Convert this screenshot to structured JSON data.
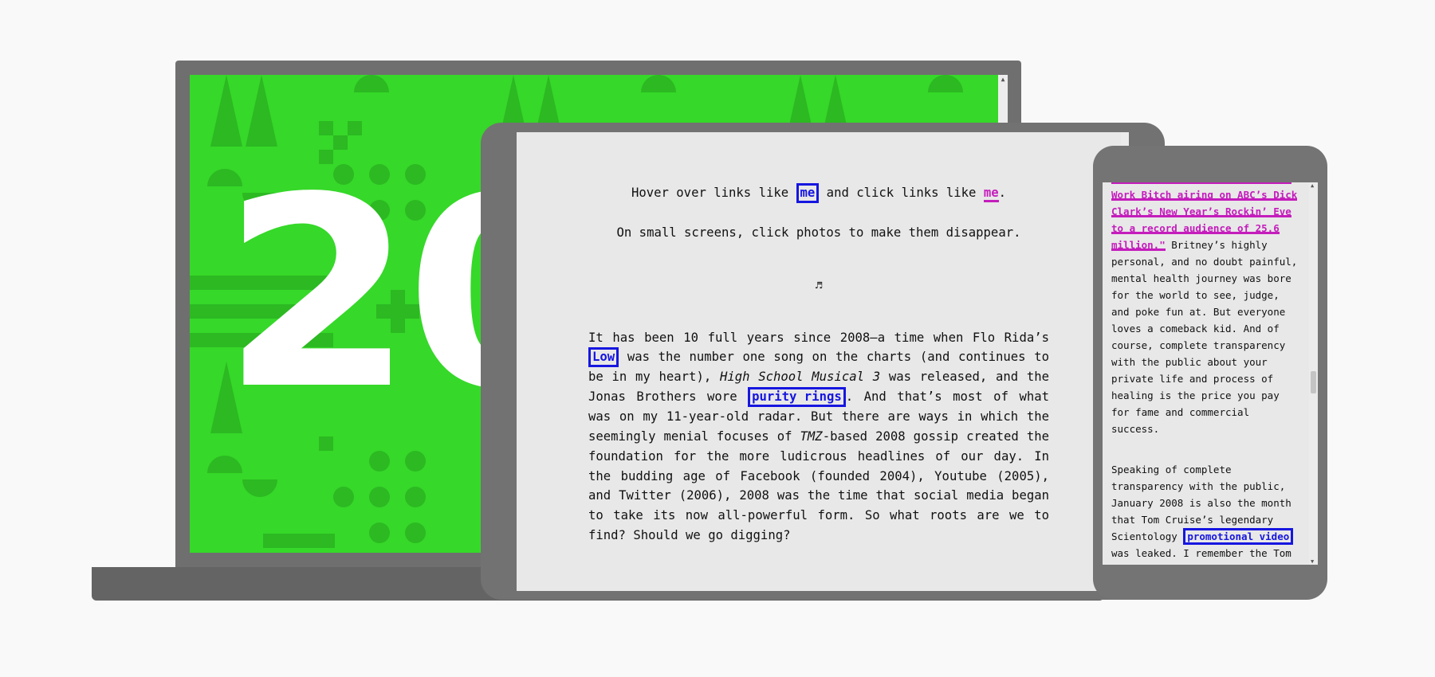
{
  "laptop": {
    "year_text": "20",
    "scroll_up_arrow": "▲",
    "colors": {
      "background": "#36d829",
      "pattern": "#2cb922",
      "text": "#ffffff"
    }
  },
  "tablet": {
    "intro": {
      "hover_prefix": "Hover over links like ",
      "hover_link": "me",
      "middle": " and click links like ",
      "click_link": "me",
      "end": "."
    },
    "small_screens_note": "On small screens, click photos to make them disappear.",
    "music_icon": "♬",
    "paragraph": {
      "p1": "It has been 10 full years since 2008—a time when Flo Rida’s ",
      "link_low": "Low",
      "p2": " was the number one song on the charts (and continues to be in my heart), ",
      "em_hsm": "High School Musical 3",
      "p3": " was released, and the Jonas Brothers wore ",
      "link_purity": "purity rings",
      "p4": ". And that’s most of what was on my 11-year-old radar. But there are ways in which the seemingly menial focuses of ",
      "em_tmz": "TMZ",
      "p5": "-based 2008 gossip created the foundation for the more ludicrous headlines of our day. In the budding age of Facebook (founded 2004), Youtube (2005), and Twitter (2006), 2008 was the time that social media began to take its now all-powerful form. So what roots are we to find? Should we go digging?"
    }
  },
  "phone": {
    "link_quote": "with performances of Toxic and Work Bitch airing on ABC’s Dick Clark’s New Year’s Rockin’ Eve to a record audience of 25.6 million.\"",
    "para1_rest": " Britney’s highly personal, and no doubt painful, mental health journey was bore for the world to see, judge, and poke fun at. But everyone loves a comeback kid. And of course, complete transparency with the public about your private life and process of healing is the price you pay for fame and commercial success.",
    "para2_start": "Speaking of complete transparency with the public, January 2008 is also the month that Tom Cruise’s legendary Scientology ",
    "link_promo": "promotional video",
    "para2_rest": " was leaked. I remember the Tom Cruise scientology jokes, but",
    "scroll_up_arrow": "▲",
    "scroll_down_arrow": "▼"
  }
}
